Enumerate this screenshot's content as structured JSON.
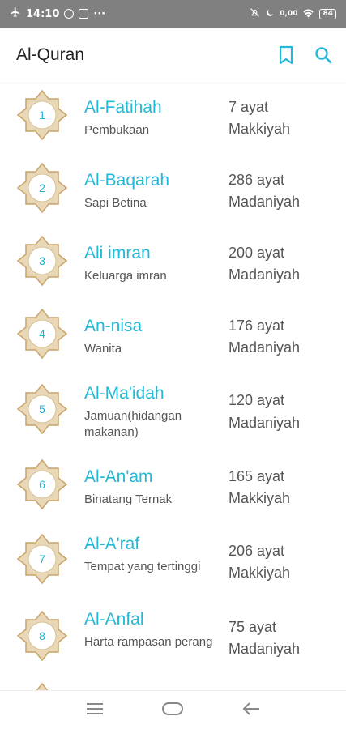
{
  "status": {
    "time": "14:10",
    "dots": "···",
    "data_speed": "0,00",
    "battery": "84"
  },
  "appbar": {
    "title": "Al-Quran",
    "bookmark_icon": "bookmark-icon",
    "search_icon": "search-icon"
  },
  "surahs": [
    {
      "number": "1",
      "name": "Al-Fatihah",
      "meaning": "Pembukaan",
      "ayat": "7 ayat",
      "type": "Makkiyah"
    },
    {
      "number": "2",
      "name": "Al-Baqarah",
      "meaning": "Sapi Betina",
      "ayat": "286 ayat",
      "type": "Madaniyah"
    },
    {
      "number": "3",
      "name": "Ali imran",
      "meaning": "Keluarga imran",
      "ayat": "200 ayat",
      "type": "Madaniyah"
    },
    {
      "number": "4",
      "name": "An-nisa",
      "meaning": "Wanita",
      "ayat": "176 ayat",
      "type": "Madaniyah"
    },
    {
      "number": "5",
      "name": "Al-Ma'idah",
      "meaning": "Jamuan(hidangan makanan)",
      "ayat": "120 ayat",
      "type": "Madaniyah"
    },
    {
      "number": "6",
      "name": "Al-An'am",
      "meaning": "Binatang Ternak",
      "ayat": "165 ayat",
      "type": "Makkiyah"
    },
    {
      "number": "7",
      "name": "Al-A'raf",
      "meaning": "Tempat yang tertinggi",
      "ayat": "206 ayat",
      "type": "Makkiyah"
    },
    {
      "number": "8",
      "name": "Al-Anfal",
      "meaning": "Harta rampasan perang",
      "ayat": "75 ayat",
      "type": "Madaniyah"
    }
  ],
  "colors": {
    "accent": "#22b8d8",
    "badge_gold": "#c8a46a"
  },
  "nav": {
    "menu_icon": "menu-icon",
    "home_icon": "home-icon",
    "back_icon": "back-icon"
  }
}
